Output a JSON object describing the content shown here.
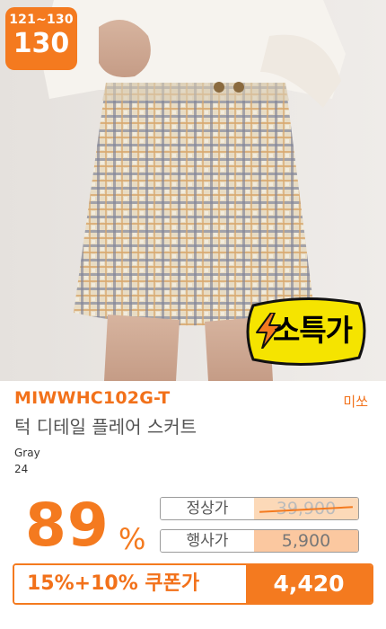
{
  "badge": {
    "size_range": "121~130",
    "size": "130",
    "special_label": "소특가"
  },
  "product": {
    "code": "MIWWHC102G-T",
    "brand": "미쏘",
    "title": "턱 디테일 플레어 스커트",
    "color": "Gray",
    "count": "24"
  },
  "discount": {
    "value": "89",
    "unit": "%"
  },
  "prices": {
    "normal_label": "정상가",
    "normal_value": "39,900",
    "event_label": "행사가",
    "event_value": "5,900"
  },
  "coupon": {
    "label": "15%+10% 쿠폰가",
    "price": "4,420"
  },
  "colors": {
    "accent": "#f47a1f",
    "badge_yellow": "#f5e400"
  }
}
